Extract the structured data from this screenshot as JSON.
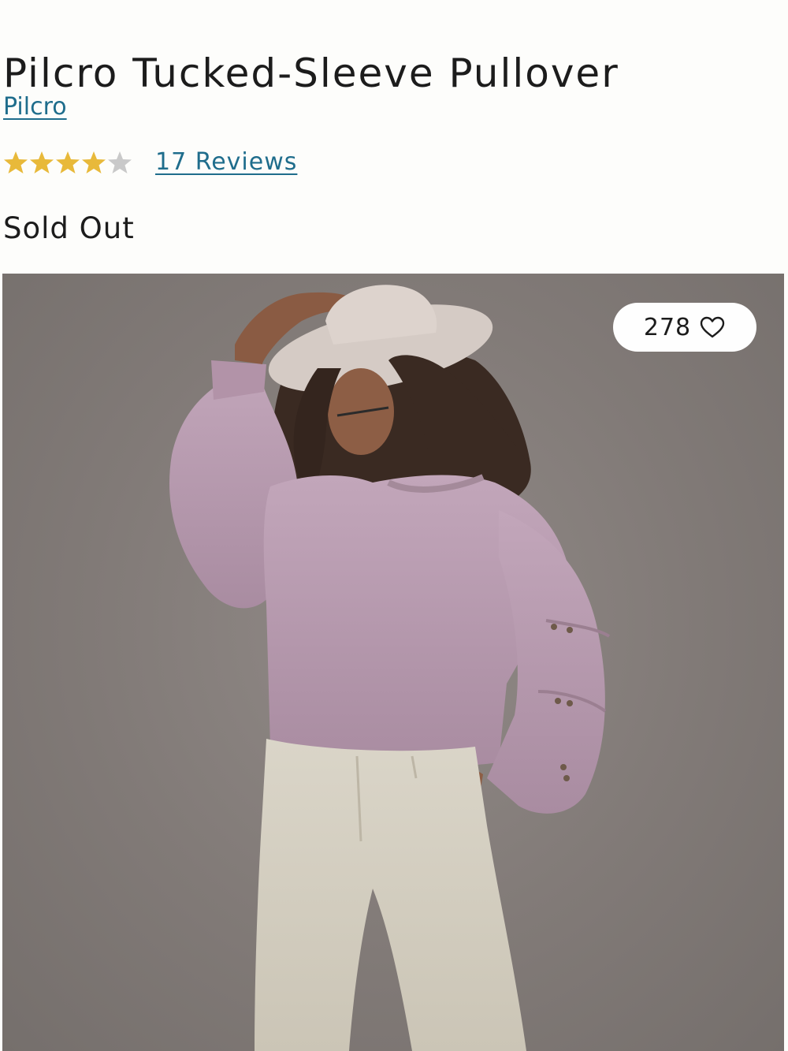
{
  "product": {
    "title": "Pilcro Tucked-Sleeve Pullover",
    "brand": "Pilcro",
    "rating": 4,
    "rating_max": 5,
    "reviews_label": "17 Reviews",
    "availability": "Sold Out"
  },
  "image": {
    "alt": "Model wearing lavender tucked-sleeve pullover, cream cowboy hat and cream wide-leg pants",
    "favorites_count": "278",
    "favorite_icon": "heart-icon"
  },
  "colors": {
    "link": "#1f6d8c",
    "star_filled": "#e8b93a",
    "star_empty": "#c9c9c9",
    "sweater": "#b99bb0",
    "backdrop": "#857e7b"
  }
}
